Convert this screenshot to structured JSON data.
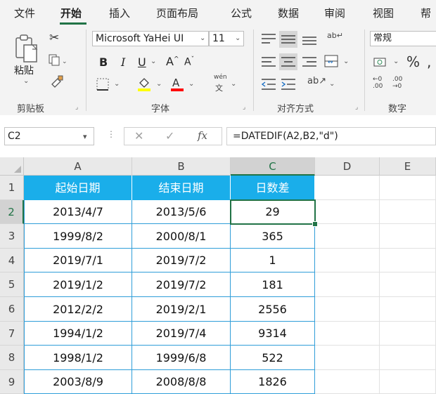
{
  "menu": {
    "items": [
      "文件",
      "开始",
      "插入",
      "页面布局",
      "公式",
      "数据",
      "审阅",
      "视图",
      "帮"
    ],
    "active": "开始"
  },
  "ribbon": {
    "clipboard": {
      "paste_label": "粘贴",
      "group_label": "剪贴板"
    },
    "font": {
      "font_name": "Microsoft YaHei UI",
      "font_size": "11",
      "bold": "B",
      "italic": "I",
      "underline": "U",
      "grow": "A",
      "shrink": "A",
      "phonetic_top": "wén",
      "phonetic_bottom": "文",
      "highlight_color": "#ffff00",
      "font_color": "#ff0000",
      "group_label": "字体"
    },
    "alignment": {
      "group_label": "对齐方式"
    },
    "number": {
      "format": "常规",
      "percent": "%",
      "comma": ",",
      "inc_decimal": "←0 .00",
      "dec_decimal": ".00 →0",
      "group_label": "数字"
    }
  },
  "formula_bar": {
    "name_box": "C2",
    "fx": "fx",
    "formula": "=DATEDIF(A2,B2,\"d\")"
  },
  "sheet": {
    "columns": [
      "A",
      "B",
      "C",
      "D",
      "E"
    ],
    "selected_cell": "C2",
    "rows": [
      {
        "num": "1",
        "a": "起始日期",
        "b": "结束日期",
        "c": "日数差"
      },
      {
        "num": "2",
        "a": "2013/4/7",
        "b": "2013/5/6",
        "c": "29"
      },
      {
        "num": "3",
        "a": "1999/8/2",
        "b": "2000/8/1",
        "c": "365"
      },
      {
        "num": "4",
        "a": "2019/7/1",
        "b": "2019/7/2",
        "c": "1"
      },
      {
        "num": "5",
        "a": "2019/1/2",
        "b": "2019/7/2",
        "c": "181"
      },
      {
        "num": "6",
        "a": "2012/2/2",
        "b": "2019/2/1",
        "c": "2556"
      },
      {
        "num": "7",
        "a": "1994/1/2",
        "b": "2019/7/4",
        "c": "9314"
      },
      {
        "num": "8",
        "a": "1998/1/2",
        "b": "1999/6/8",
        "c": "522"
      },
      {
        "num": "9",
        "a": "2003/8/9",
        "b": "2008/8/8",
        "c": "1826"
      }
    ],
    "header_color": "#1aaeea",
    "border_color": "#2f9ed9",
    "accent_color": "#217346"
  }
}
